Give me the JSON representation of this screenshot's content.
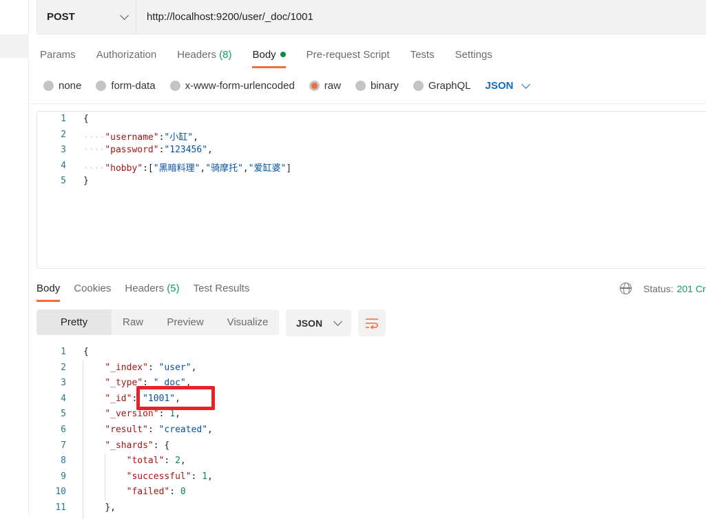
{
  "request": {
    "method": "POST",
    "url": "http://localhost:9200/user/_doc/1001"
  },
  "request_tabs": [
    {
      "label": "Params"
    },
    {
      "label": "Authorization"
    },
    {
      "label": "Headers",
      "count": "(8)"
    },
    {
      "label": "Body",
      "active": true,
      "dot": true
    },
    {
      "label": "Pre-request Script"
    },
    {
      "label": "Tests"
    },
    {
      "label": "Settings"
    }
  ],
  "body_types": [
    {
      "label": "none"
    },
    {
      "label": "form-data"
    },
    {
      "label": "x-www-form-urlencoded"
    },
    {
      "label": "raw",
      "selected": true
    },
    {
      "label": "binary"
    },
    {
      "label": "GraphQL"
    }
  ],
  "body_format": "JSON",
  "request_body": [
    [
      [
        "p",
        "{"
      ]
    ],
    [
      [
        "w",
        "····"
      ],
      [
        "k",
        "\"username\""
      ],
      [
        "p",
        ":"
      ],
      [
        "s",
        "\"小缸\""
      ],
      [
        "p",
        ","
      ]
    ],
    [
      [
        "w",
        "····"
      ],
      [
        "k",
        "\"password\""
      ],
      [
        "p",
        ":"
      ],
      [
        "s",
        "\"123456\""
      ],
      [
        "p",
        ","
      ]
    ],
    [
      [
        "w",
        "····"
      ],
      [
        "k",
        "\"hobby\""
      ],
      [
        "p",
        ":["
      ],
      [
        "s",
        "\"黑暗料理\""
      ],
      [
        "p",
        ","
      ],
      [
        "s",
        "\"骑摩托\""
      ],
      [
        "p",
        ","
      ],
      [
        "s",
        "\"爱缸婆\""
      ],
      [
        "p",
        "]"
      ]
    ],
    [
      [
        "p",
        "}"
      ]
    ]
  ],
  "response_tabs": [
    {
      "label": "Body",
      "active": true
    },
    {
      "label": "Cookies"
    },
    {
      "label": "Headers",
      "count": "(5)"
    },
    {
      "label": "Test Results"
    }
  ],
  "status": {
    "label": "Status:",
    "value": "201 Cr"
  },
  "view_modes": [
    "Pretty",
    "Raw",
    "Preview",
    "Visualize"
  ],
  "response_format": "JSON",
  "response_body": [
    [
      [
        "p",
        "{"
      ]
    ],
    [
      [
        "w",
        "    "
      ],
      [
        "k",
        "\"_index\""
      ],
      [
        "p",
        ": "
      ],
      [
        "s",
        "\"user\""
      ],
      [
        "p",
        ","
      ]
    ],
    [
      [
        "w",
        "    "
      ],
      [
        "k",
        "\"_type\""
      ],
      [
        "p",
        ": "
      ],
      [
        "s",
        "\"_doc\""
      ],
      [
        "p",
        ","
      ]
    ],
    [
      [
        "w",
        "    "
      ],
      [
        "k",
        "\"_id\""
      ],
      [
        "p",
        ": "
      ],
      [
        "s",
        "\"1001\""
      ],
      [
        "p",
        ","
      ]
    ],
    [
      [
        "w",
        "    "
      ],
      [
        "k",
        "\"_version\""
      ],
      [
        "p",
        ": "
      ],
      [
        "n",
        "1"
      ],
      [
        "p",
        ","
      ]
    ],
    [
      [
        "w",
        "    "
      ],
      [
        "k",
        "\"result\""
      ],
      [
        "p",
        ": "
      ],
      [
        "s",
        "\"created\""
      ],
      [
        "p",
        ","
      ]
    ],
    [
      [
        "w",
        "    "
      ],
      [
        "k",
        "\"_shards\""
      ],
      [
        "p",
        ": {"
      ]
    ],
    [
      [
        "w",
        "        "
      ],
      [
        "k",
        "\"total\""
      ],
      [
        "p",
        ": "
      ],
      [
        "n",
        "2"
      ],
      [
        "p",
        ","
      ]
    ],
    [
      [
        "w",
        "        "
      ],
      [
        "k",
        "\"successful\""
      ],
      [
        "p",
        ": "
      ],
      [
        "n",
        "1"
      ],
      [
        "p",
        ","
      ]
    ],
    [
      [
        "w",
        "        "
      ],
      [
        "k",
        "\"failed\""
      ],
      [
        "p",
        ": "
      ],
      [
        "n",
        "0"
      ]
    ],
    [
      [
        "w",
        "    "
      ],
      [
        "p",
        "},"
      ]
    ]
  ],
  "colors": {
    "accent": "#f26b3a",
    "highlight_box": "#e8202a",
    "status_ok": "#0f9d58"
  }
}
